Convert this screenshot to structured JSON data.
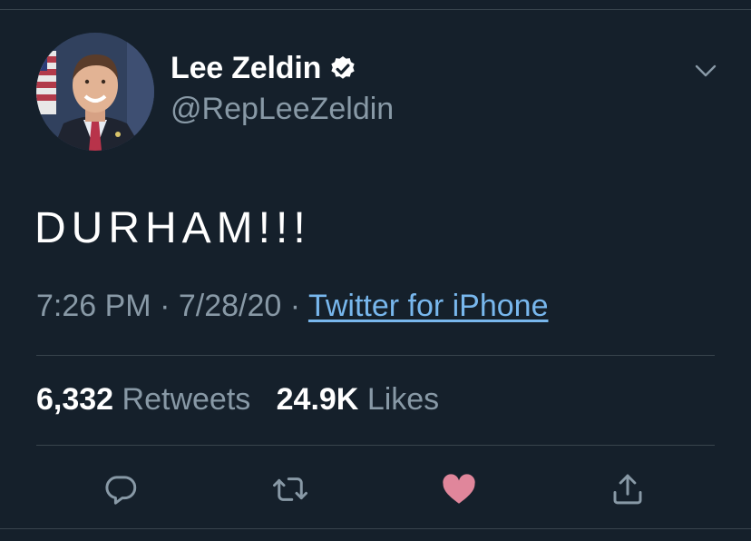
{
  "tweet": {
    "author_name": "Lee Zeldin",
    "author_handle": "@RepLeeZeldin",
    "text": "DURHAM!!!",
    "time": "7:26 PM",
    "date": "7/28/20",
    "separator": "·",
    "source": "Twitter for iPhone",
    "verified": true
  },
  "stats": {
    "retweets_count": "6,332",
    "retweets_label": "Retweets",
    "likes_count": "24.9K",
    "likes_label": "Likes"
  },
  "actions": [
    {
      "icon": "reply-icon"
    },
    {
      "icon": "retweet-icon"
    },
    {
      "icon": "like-icon",
      "active": true
    },
    {
      "icon": "share-icon"
    }
  ],
  "colors": {
    "background": "#15202b",
    "text_primary": "#ffffff",
    "text_secondary": "#8899a6",
    "link": "#78b7ed",
    "like_active": "#e0869b",
    "divider": "#38444d"
  }
}
